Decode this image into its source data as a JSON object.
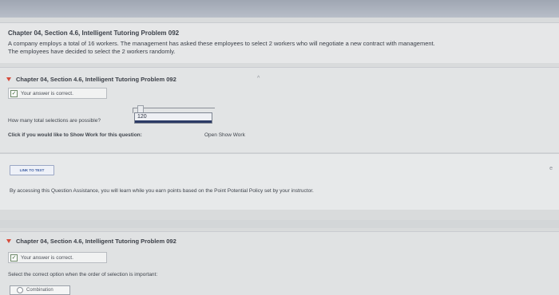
{
  "intro": {
    "title": "Chapter 04, Section 4.6, Intelligent Tutoring Problem 092",
    "line1": "A company employs a total of 16 workers. The management has asked these employees to select 2 workers who will negotiate a new contract with management.",
    "line2": "The employees have decided to select the 2 workers randomly."
  },
  "q1": {
    "header": "Chapter 04, Section 4.6, Intelligent Tutoring Problem 092",
    "status": "Your answer is correct.",
    "question": "How many total selections are possible?",
    "answer": "120",
    "show_work_prompt": "Click if you would like to Show Work for this question:",
    "show_work_link": "Open Show Work"
  },
  "links": {
    "link_to_text": "LINK TO TEXT",
    "assistance_note": "By accessing this Question Assistance, you will learn while you earn points based on the Point Potential Policy set by your instructor."
  },
  "q2": {
    "header": "Chapter 04, Section 4.6, Intelligent Tutoring Problem 092",
    "status": "Your answer is correct.",
    "question": "Select the correct option when the order of selection is important:",
    "option": "Combination"
  },
  "colors": {
    "accent_triangle": "#d64b3b",
    "link_blue": "#3d5ea3",
    "correct_green": "#3f6f3a"
  }
}
